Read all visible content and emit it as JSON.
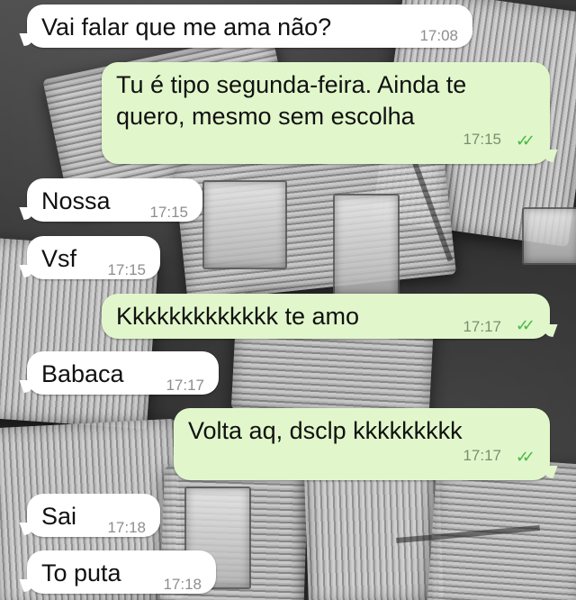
{
  "messages": [
    {
      "direction": "in",
      "text": "Vai falar que me ama não?",
      "time": "17:08"
    },
    {
      "direction": "out",
      "text": "Tu é tipo segunda-feira. Ainda te quero, mesmo sem escolha",
      "time": "17:15",
      "status": "read"
    },
    {
      "direction": "in",
      "text": "Nossa",
      "time": "17:15"
    },
    {
      "direction": "in",
      "text": "Vsf",
      "time": "17:15"
    },
    {
      "direction": "out",
      "text": "Kkkkkkkkkkkkk te amo",
      "time": "17:17",
      "status": "read"
    },
    {
      "direction": "in",
      "text": "Babaca",
      "time": "17:17"
    },
    {
      "direction": "out",
      "text": "Volta aq, dsclp kkkkkkkkk",
      "time": "17:17",
      "status": "read"
    },
    {
      "direction": "in",
      "text": "Sai",
      "time": "17:18"
    },
    {
      "direction": "in",
      "text": "To puta",
      "time": "17:18"
    }
  ],
  "theme": {
    "incoming_bg": "#ffffff",
    "outgoing_bg": "#e1f7cb",
    "read_tick_color": "#48b848"
  },
  "icons": {
    "read_receipt": "double-check-icon"
  }
}
